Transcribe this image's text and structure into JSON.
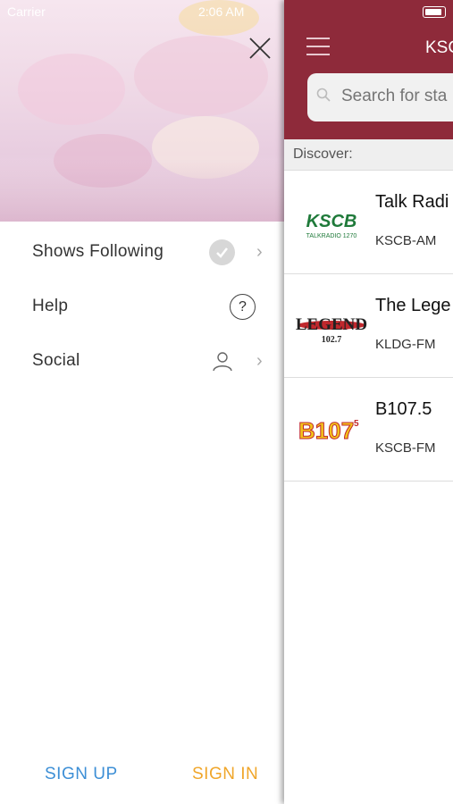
{
  "status": {
    "carrier": "Carrier",
    "time": "2:06 AM"
  },
  "drawer": {
    "menu": [
      {
        "label": "Shows Following"
      },
      {
        "label": "Help",
        "icon_text": "?"
      },
      {
        "label": "Social"
      }
    ],
    "sign_up": "SIGN UP",
    "sign_in": "SIGN IN",
    "colors": {
      "sign_up": "#3d8fd6",
      "sign_in": "#f0a62a"
    }
  },
  "main": {
    "title": "KSCB",
    "search_placeholder": "Search for sta",
    "discover_label": "Discover:",
    "accent": "#8e2a3a",
    "stations": [
      {
        "name": "Talk Radi",
        "call": "KSCB-AM",
        "logo_text": "KSCB",
        "logo_sub": "TALKRADIO 1270"
      },
      {
        "name": "The Lege",
        "call": "KLDG-FM",
        "logo_text": "LEGEND",
        "logo_sub": "102.7"
      },
      {
        "name": "B107.5",
        "call": "KSCB-FM",
        "logo_text": "B107",
        "logo_sub": "5"
      }
    ]
  }
}
